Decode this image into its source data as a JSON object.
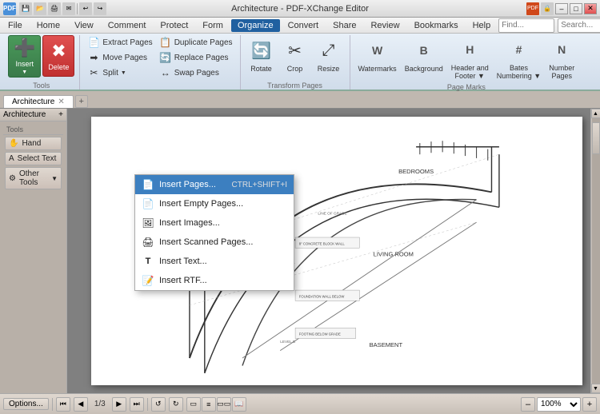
{
  "app": {
    "title": "Architecture - PDF-XChange Editor",
    "icon": "PDF"
  },
  "titlebar": {
    "minimize": "–",
    "maximize": "□",
    "close": "✕",
    "toolbar_icons": [
      "💾",
      "📁",
      "✉",
      "🖨",
      "🔄",
      "↩",
      "↪"
    ]
  },
  "menubar": {
    "items": [
      "File",
      "Home",
      "View",
      "Comment",
      "Protect",
      "Form",
      "Organize",
      "Convert",
      "Share",
      "Review",
      "Bookmarks",
      "Help"
    ],
    "active": "Organize"
  },
  "ribbon": {
    "groups": [
      {
        "label": "Tools",
        "items_large": [
          {
            "id": "insert",
            "label": "Insert",
            "color": "green"
          },
          {
            "id": "delete",
            "label": "Delete",
            "color": "red"
          }
        ],
        "items_small": []
      },
      {
        "label": "",
        "small_groups": [
          {
            "items": [
              {
                "label": "Extract Pages",
                "icon": "📄"
              },
              {
                "label": "Move Pages",
                "icon": "➡"
              },
              {
                "label": "Split",
                "icon": "✂",
                "has_arrow": true
              }
            ]
          },
          {
            "items": [
              {
                "label": "Duplicate Pages",
                "icon": "📋"
              },
              {
                "label": "Replace Pages",
                "icon": "🔄"
              },
              {
                "label": "Swap Pages",
                "icon": "↔"
              }
            ]
          }
        ],
        "group_label": ""
      },
      {
        "label": "Transform Pages",
        "large_items": [
          {
            "label": "Rotate",
            "icon": "🔄"
          },
          {
            "label": "Crop",
            "icon": "✂"
          },
          {
            "label": "Resize",
            "icon": "⤢"
          }
        ]
      },
      {
        "label": "Page Marks",
        "large_items": [
          {
            "label": "Watermarks",
            "icon": "W"
          },
          {
            "label": "Background",
            "icon": "B"
          },
          {
            "label": "Header and\nFooter",
            "icon": "H"
          },
          {
            "label": "Bates\nNumbering",
            "icon": "#"
          },
          {
            "label": "Number\nPages",
            "icon": "N"
          }
        ]
      }
    ],
    "find_label": "Find...",
    "search_label": "Search..."
  },
  "dropdown_menu": {
    "items": [
      {
        "label": "Insert Pages...",
        "shortcut": "CTRL+SHIFT+I",
        "icon": "📄",
        "highlighted": true
      },
      {
        "label": "Insert Empty Pages...",
        "icon": "📄",
        "highlighted": false
      },
      {
        "label": "Insert Images...",
        "icon": "🖼",
        "highlighted": false
      },
      {
        "label": "Insert Scanned Pages...",
        "icon": "🖨",
        "highlighted": false
      },
      {
        "label": "Insert Text...",
        "icon": "T",
        "highlighted": false
      },
      {
        "label": "Insert RTF...",
        "icon": "📝",
        "highlighted": false
      }
    ]
  },
  "sidebar": {
    "tab_label": "Architecture",
    "tools": [
      {
        "label": "Hand",
        "icon": "✋"
      },
      {
        "label": "Select Text",
        "icon": "A"
      },
      {
        "label": "Other Tools",
        "icon": "⚙",
        "has_arrow": true
      }
    ],
    "tools_section_label": "Tools"
  },
  "doc_tab": {
    "label": "Architecture",
    "closeable": true
  },
  "statusbar": {
    "options_label": "Options...",
    "page_info": "1/3",
    "zoom_value": "100%",
    "nav_buttons": [
      "⏮",
      "◀",
      "▶",
      "⏭"
    ],
    "zoom_out": "–",
    "zoom_in": "+"
  }
}
